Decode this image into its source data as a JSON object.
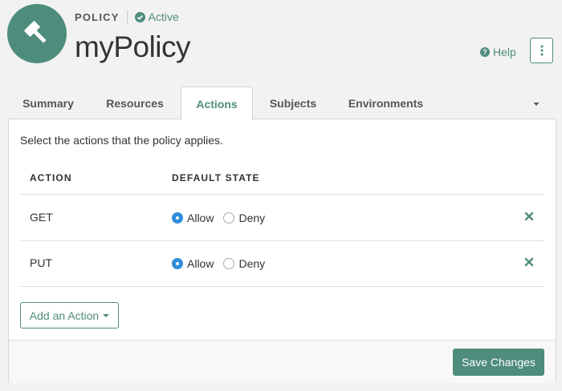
{
  "header": {
    "logo_icon": "gavel-icon",
    "type_label": "POLICY",
    "status": {
      "icon": "check-circle-icon",
      "label": "Active"
    },
    "title": "myPolicy",
    "help_label": "Help",
    "help_icon": "question-circle-icon",
    "menu_icon": "kebab-icon"
  },
  "tabs": {
    "items": [
      {
        "label": "Summary"
      },
      {
        "label": "Resources"
      },
      {
        "label": "Actions",
        "active": true
      },
      {
        "label": "Subjects"
      },
      {
        "label": "Environments"
      }
    ],
    "more_icon": "caret-down-icon"
  },
  "actions": {
    "intro": "Select the actions that the policy applies.",
    "columns": {
      "action": "ACTION",
      "default_state": "DEFAULT STATE"
    },
    "rows": [
      {
        "name": "GET",
        "allow_label": "Allow",
        "deny_label": "Deny",
        "selected": "Allow"
      },
      {
        "name": "PUT",
        "allow_label": "Allow",
        "deny_label": "Deny",
        "selected": "Allow"
      }
    ],
    "add_label": "Add an Action"
  },
  "footer": {
    "save_label": "Save Changes"
  },
  "colors": {
    "accent": "#4e8c7c",
    "radio_selected": "#2f8ddb",
    "background": "#f2f2f2"
  }
}
